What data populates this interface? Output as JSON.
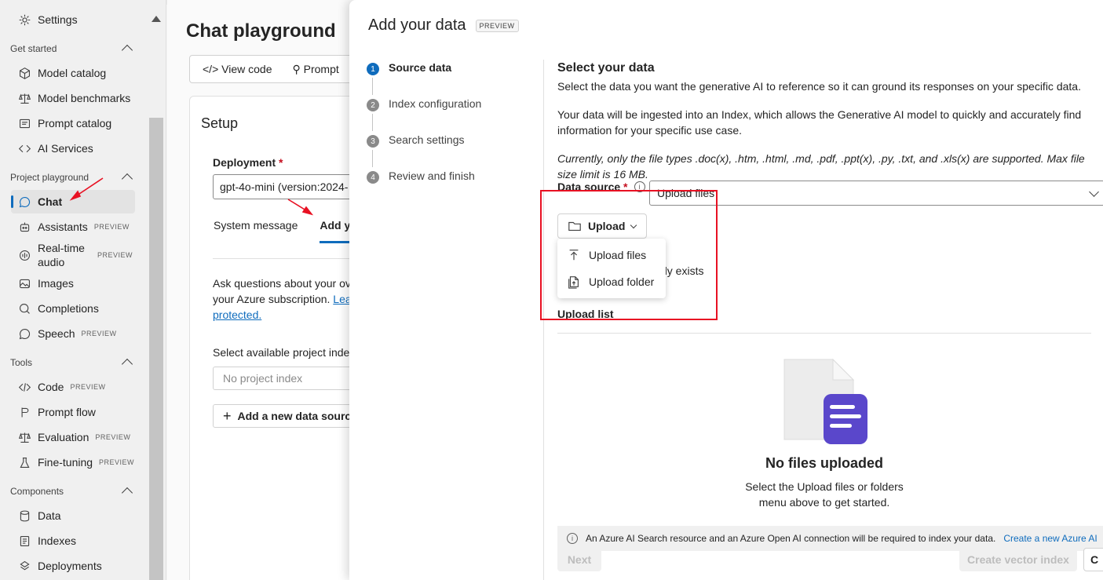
{
  "sidebar": {
    "top_item": "Settings",
    "sections": {
      "get_started": "Get started",
      "project_playground": "Project playground",
      "tools": "Tools",
      "components": "Components"
    },
    "get_started_items": [
      "Model catalog",
      "Model benchmarks",
      "Prompt catalog",
      "AI Services"
    ],
    "playground_items": {
      "chat": "Chat",
      "assistants": "Assistants",
      "realtime_line1": "Real-time",
      "realtime_line2": "audio",
      "images": "Images",
      "completions": "Completions",
      "speech": "Speech"
    },
    "tools_items": {
      "code": "Code",
      "prompt_flow": "Prompt flow",
      "evaluation": "Evaluation",
      "fine_tuning": "Fine-tuning"
    },
    "components_items": [
      "Data",
      "Indexes",
      "Deployments"
    ],
    "badge": "PREVIEW"
  },
  "main": {
    "title": "Chat playground",
    "toolbar": {
      "view_code": "View code",
      "prompt": "Prompt"
    },
    "setup": {
      "title": "Setup",
      "deployment_label": "Deployment",
      "deployment_value": "gpt-4o-mini (version:2024-",
      "tab_system": "System message",
      "tab_add": "Add yo",
      "desc_line1": "Ask questions about your ov",
      "desc_line2": "your Azure subscription. ",
      "desc_link": "Lea",
      "desc_link2": "protected.",
      "index_label": "Select available project index",
      "index_placeholder": "No project index",
      "add_source": "Add a new data sourc"
    }
  },
  "panel": {
    "title": "Add your data",
    "badge": "PREVIEW",
    "steps": [
      {
        "num": "1",
        "label": "Source data"
      },
      {
        "num": "2",
        "label": "Index configuration"
      },
      {
        "num": "3",
        "label": "Search settings"
      },
      {
        "num": "4",
        "label": "Review and finish"
      }
    ],
    "heading": "Select your data",
    "para1": "Select the data you want the generative AI to reference so it can ground its responses on your specific data.",
    "para2": "Your data will be ingested into an Index, which allows the Generative AI model to quickly and accurately find information for your specific use case.",
    "para3": "Currently, only the file types .doc(x), .htm, .html, .md, .pdf, .ppt(x), .py, .txt, and .xls(x) are supported. Max file size limit is 16 MB.",
    "data_source_label": "Data source",
    "data_source_value": "Upload files",
    "upload_button": "Upload",
    "menu": {
      "upload_files": "Upload files",
      "upload_folder": "Upload folder"
    },
    "exists_text": "dy exists",
    "upload_list": "Upload list",
    "empty_title": "No files uploaded",
    "empty_desc": "Select the Upload files or folders menu above to get started.",
    "notice_text": "An Azure AI Search resource and an Azure Open AI connection will be required to index your data.",
    "notice_link": "Create a new Azure AI",
    "next_button": "Next",
    "create_button": "Create vector index",
    "cancel_button": "C"
  }
}
